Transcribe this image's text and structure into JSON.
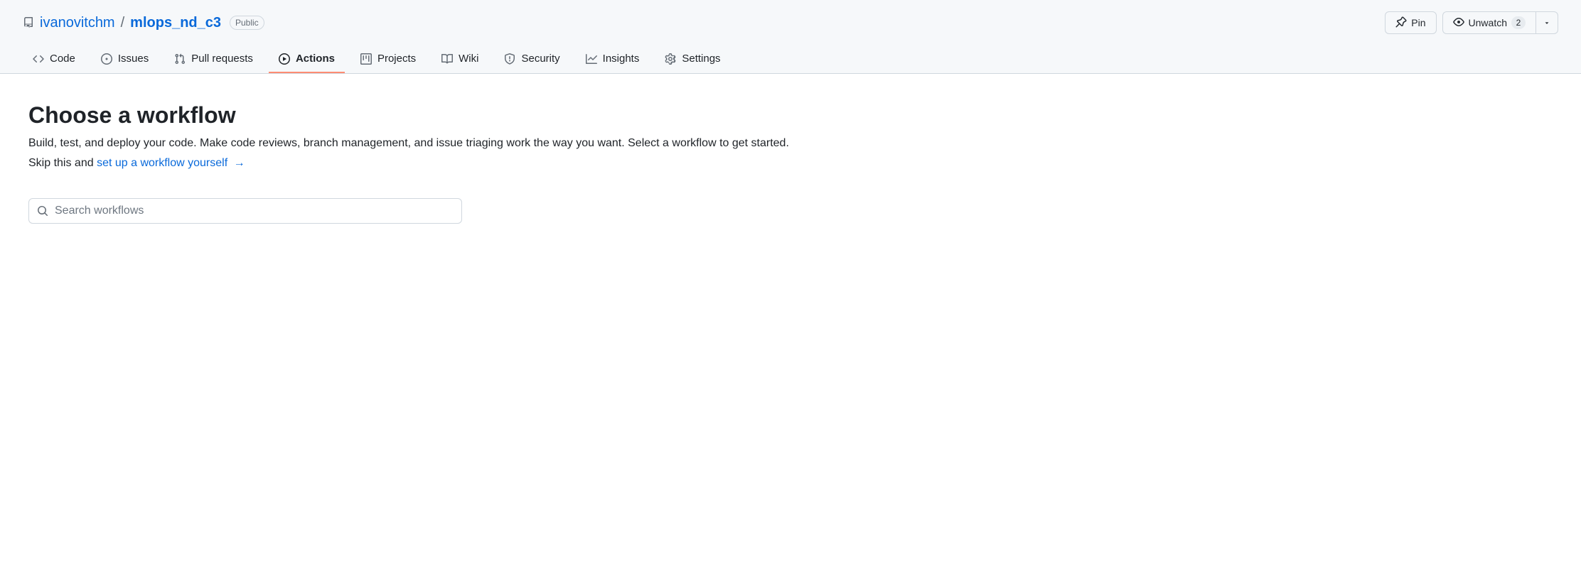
{
  "repo": {
    "owner": "ivanovitchm",
    "name": "mlops_nd_c3",
    "visibility": "Public"
  },
  "actions": {
    "pin": "Pin",
    "unwatch": "Unwatch",
    "unwatch_count": "2"
  },
  "tabs": {
    "code": "Code",
    "issues": "Issues",
    "pulls": "Pull requests",
    "actions": "Actions",
    "projects": "Projects",
    "wiki": "Wiki",
    "security": "Security",
    "insights": "Insights",
    "settings": "Settings"
  },
  "main": {
    "heading": "Choose a workflow",
    "subtitle": "Build, test, and deploy your code. Make code reviews, branch management, and issue triaging work the way you want. Select a workflow to get started.",
    "skip_prefix": "Skip this and ",
    "skip_link": "set up a workflow yourself",
    "search_placeholder": "Search workflows"
  }
}
